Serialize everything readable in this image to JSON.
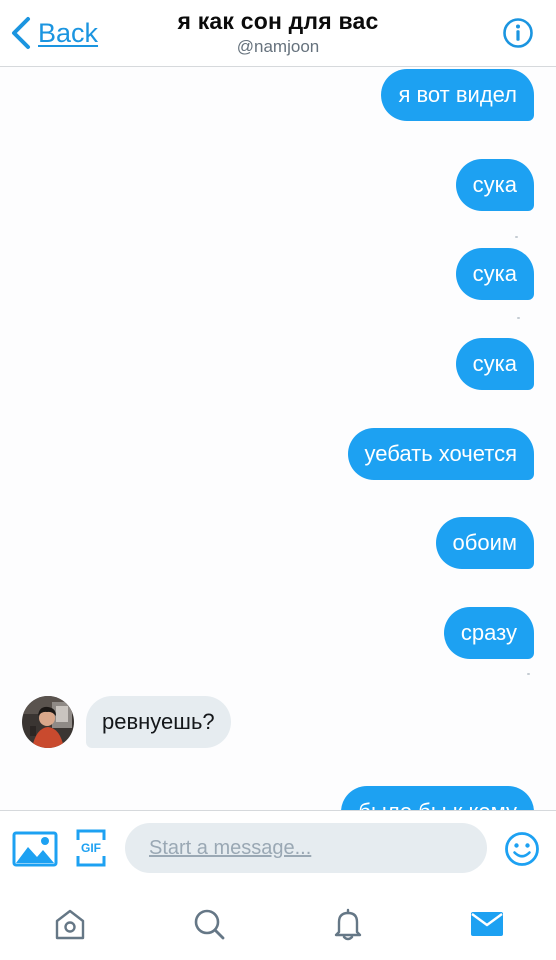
{
  "header": {
    "back_label": "Back",
    "title": "я как сон для вас",
    "handle": "@namjoon"
  },
  "messages": [
    {
      "direction": "outgoing",
      "text": "я вот видел"
    },
    {
      "direction": "outgoing",
      "text": "сука"
    },
    {
      "direction": "outgoing",
      "text": "сука"
    },
    {
      "direction": "outgoing",
      "text": "сука"
    },
    {
      "direction": "outgoing",
      "text": "уебать хочется"
    },
    {
      "direction": "outgoing",
      "text": "обоим"
    },
    {
      "direction": "outgoing",
      "text": "сразу"
    },
    {
      "direction": "incoming",
      "text": "ревнуешь?"
    },
    {
      "direction": "outgoing",
      "text": "было бы к кому"
    }
  ],
  "composer": {
    "placeholder": "Start a message...",
    "gif_label": "GIF"
  },
  "tabbar": {
    "items": [
      "home-icon",
      "search-icon",
      "notifications-icon",
      "messages-icon"
    ],
    "active": "messages-icon"
  },
  "colors": {
    "accent": "#1da1f2",
    "link": "#1b95e0",
    "incoming_bubble": "#e6ecf0",
    "tab_inactive": "#657786"
  }
}
